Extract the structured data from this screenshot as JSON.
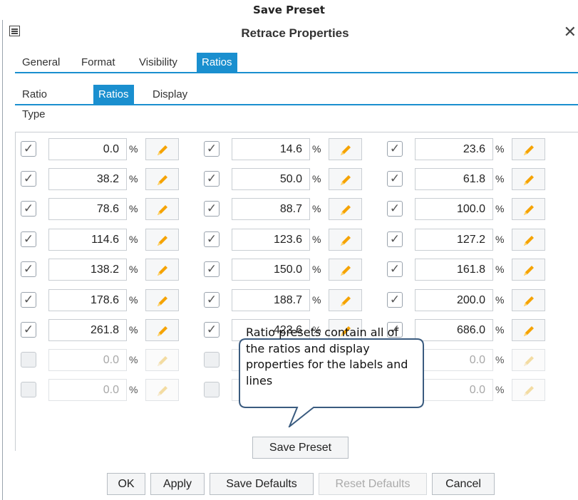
{
  "page_heading": "Save Preset",
  "dialog": {
    "title": "Retrace Properties",
    "close_glyph": "✕"
  },
  "main_tabs": [
    {
      "label": "General",
      "active": false
    },
    {
      "label": "Format",
      "active": false
    },
    {
      "label": "Visibility",
      "active": false
    },
    {
      "label": "Ratios",
      "active": true
    }
  ],
  "sub_tabs": [
    {
      "label": "Ratio Type",
      "active": false
    },
    {
      "label": "Ratios",
      "active": true
    },
    {
      "label": "Display",
      "active": false
    }
  ],
  "ratios": {
    "unit": "%",
    "rows": [
      [
        {
          "value": "0.0",
          "enabled": true
        },
        {
          "value": "14.6",
          "enabled": true
        },
        {
          "value": "23.6",
          "enabled": true
        }
      ],
      [
        {
          "value": "38.2",
          "enabled": true
        },
        {
          "value": "50.0",
          "enabled": true
        },
        {
          "value": "61.8",
          "enabled": true
        }
      ],
      [
        {
          "value": "78.6",
          "enabled": true
        },
        {
          "value": "88.7",
          "enabled": true
        },
        {
          "value": "100.0",
          "enabled": true
        }
      ],
      [
        {
          "value": "114.6",
          "enabled": true
        },
        {
          "value": "123.6",
          "enabled": true
        },
        {
          "value": "127.2",
          "enabled": true
        }
      ],
      [
        {
          "value": "138.2",
          "enabled": true
        },
        {
          "value": "150.0",
          "enabled": true
        },
        {
          "value": "161.8",
          "enabled": true
        }
      ],
      [
        {
          "value": "178.6",
          "enabled": true
        },
        {
          "value": "188.7",
          "enabled": true
        },
        {
          "value": "200.0",
          "enabled": true
        }
      ],
      [
        {
          "value": "261.8",
          "enabled": true
        },
        {
          "value": "423.6",
          "enabled": true
        },
        {
          "value": "686.0",
          "enabled": true
        }
      ],
      [
        {
          "value": "0.0",
          "enabled": false
        },
        {
          "value": "",
          "enabled": false
        },
        {
          "value": "0.0",
          "enabled": false
        }
      ],
      [
        {
          "value": "0.0",
          "enabled": false
        },
        {
          "value": "",
          "enabled": false
        },
        {
          "value": "0.0",
          "enabled": false
        }
      ]
    ]
  },
  "callout": {
    "text": "Ratio presets contain all of the ratios and display properties for the labels and lines"
  },
  "save_preset_label": "Save Preset",
  "footer": {
    "ok": "OK",
    "apply": "Apply",
    "save_defaults": "Save Defaults",
    "reset_defaults": "Reset Defaults",
    "cancel": "Cancel"
  },
  "icons": {
    "check": "check-icon",
    "edit": "pencil-icon",
    "dialog": "properties-icon",
    "close": "close-icon"
  },
  "colors": {
    "accent": "#1a8fcf",
    "pencil": "#f5a300",
    "pencil_disabled": "#f3dca2"
  }
}
